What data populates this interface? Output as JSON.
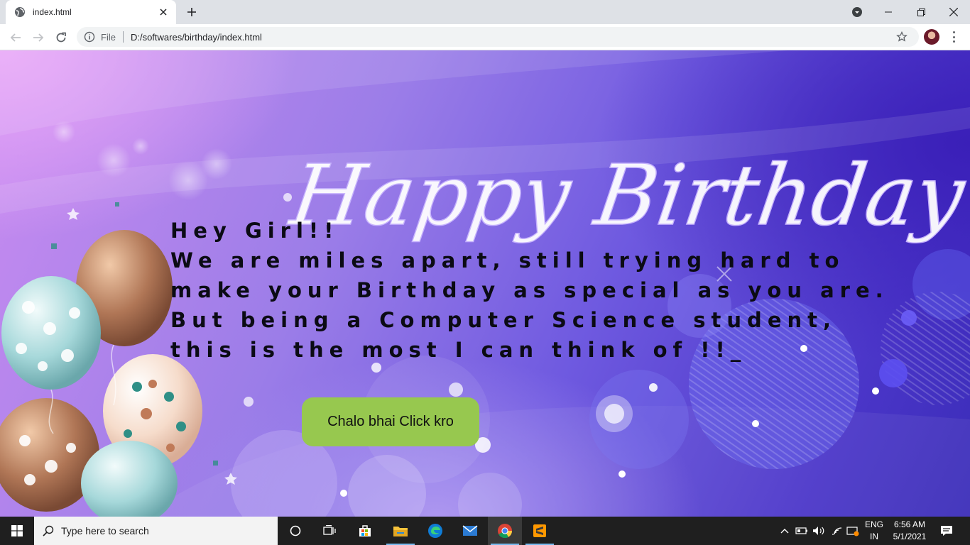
{
  "browser": {
    "tab_title": "index.html",
    "omnibox_scheme_label": "File",
    "url": "D:/softwares/birthday/index.html"
  },
  "page": {
    "heading_art": "Happy Birthday",
    "lines": [
      "Hey Girl!!",
      "We are miles apart, still trying hard to",
      "make your Birthday as special as you are.",
      "But being a Computer Science student,",
      "this is the most I can think of !!_"
    ],
    "button_label": "Chalo bhai Click kro",
    "button_color": "#97c84f"
  },
  "taskbar": {
    "search_placeholder": "Type here to search",
    "lang_top": "ENG",
    "lang_bottom": "IN",
    "time": "6:56 AM",
    "date": "5/1/2021"
  }
}
